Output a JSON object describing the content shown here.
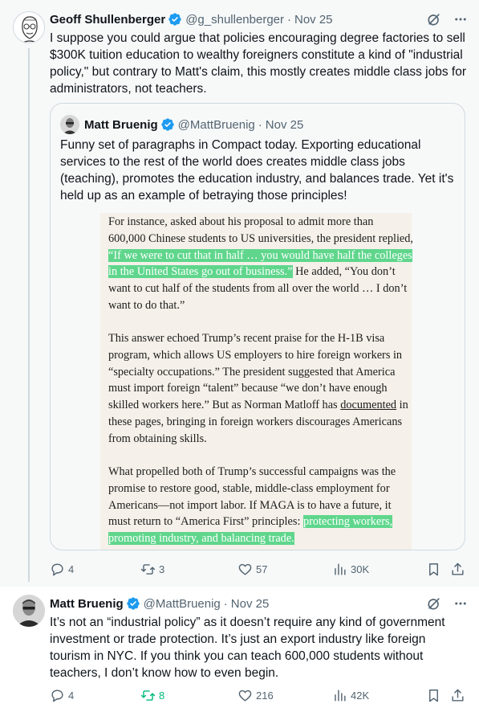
{
  "tweet1": {
    "author_name": "Geoff Shullenberger",
    "handle": "@g_shullenberger",
    "separator": "·",
    "date": "Nov 25",
    "text": "I suppose you could argue that policies encouraging degree factories to sell $300K tuition education to wealthy foreigners constitute a kind of \"industrial policy,\" but contrary to Matt's claim, this mostly creates middle class jobs for administrators, not teachers.",
    "quote": {
      "author_name": "Matt Bruenig",
      "handle": "@MattBruenig",
      "separator": "·",
      "date": "Nov 25",
      "text": "Funny set of paragraphs in Compact today. Exporting educational services to the rest of the world does creates middle class jobs (teaching), promotes the education industry, and balances trade. Yet it's held up as an example of betraying those principles!",
      "excerpt": {
        "p1_before": "For instance, asked about his proposal to admit more than 600,000 Chinese students to US universities, the president replied, ",
        "p1_highlight": "“If we were to cut that in half … you would have half the colleges in the United States go out of business.”",
        "p1_after": " He added, “You don’t want to cut half of the students from all over the world … I don’t want to do that.”",
        "p2_before": "This answer echoed Trump’s recent praise for the H-1B visa program, which allows US employers to hire foreign workers in “specialty occupations.” The president suggested that America must import foreign “talent” because “we don’t have enough skilled workers here.” But as Norman Matloff has ",
        "p2_link": "documented",
        "p2_after": " in these pages, bringing in foreign workers discourages Americans from obtaining skills.",
        "p3_before": "What propelled both of Trump’s successful campaigns was the promise to restore good, stable, middle-class employment for Americans—not import labor. If MAGA is to have a future, it must return to “America First” principles: ",
        "p3_highlight": "protecting workers, promoting industry, and balancing trade."
      }
    },
    "stats": {
      "replies": "4",
      "reposts": "3",
      "likes": "57",
      "views": "30K"
    }
  },
  "tweet2": {
    "author_name": "Matt Bruenig",
    "handle": "@MattBruenig",
    "separator": "·",
    "date": "Nov 25",
    "text": "It’s not an “industrial policy” as it doesn’t require any kind of government investment or trade protection. It’s just an export industry like foreign tourism in NYC. If you think you can teach 600,000 students without teachers, I don’t know how to even begin.",
    "stats": {
      "replies": "4",
      "reposts": "8",
      "likes": "216",
      "views": "42K"
    }
  },
  "colors": {
    "verified": "#1d9bf0",
    "repost_active": "#00ba7c",
    "highlight": "#5fd68c",
    "muted_text": "#536471"
  },
  "icons": [
    "verified-badge-icon",
    "grok-icon",
    "more-icon",
    "reply-icon",
    "repost-icon",
    "like-icon",
    "views-icon",
    "bookmark-icon",
    "share-icon"
  ]
}
